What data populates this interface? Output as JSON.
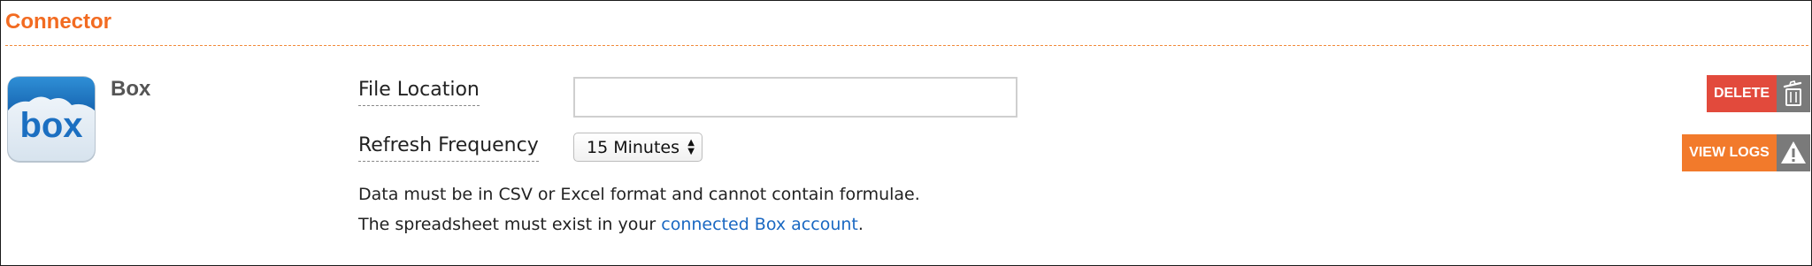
{
  "section": {
    "title": "Connector"
  },
  "connector": {
    "name": "Box",
    "icon": "box-logo-icon"
  },
  "form": {
    "file_location_label": "File Location",
    "file_location_value": "",
    "file_location_placeholder": "",
    "refresh_label": "Refresh Frequency",
    "refresh_selected": "15 Minutes"
  },
  "notes": {
    "line1": "Data must be in CSV or Excel format and cannot contain formulae.",
    "line2_prefix": "The spreadsheet must exist in your ",
    "line2_link": "connected Box account",
    "line2_suffix": "."
  },
  "actions": {
    "delete_label": "DELETE",
    "delete_icon": "trash-icon",
    "view_logs_label": "VIEW LOGS",
    "view_logs_icon": "warning-icon"
  },
  "colors": {
    "accent": "#f26b21",
    "delete": "#e24a3c",
    "view_logs": "#f27a2b",
    "icon_bg": "#7a7a7a",
    "link": "#1a68c2"
  }
}
